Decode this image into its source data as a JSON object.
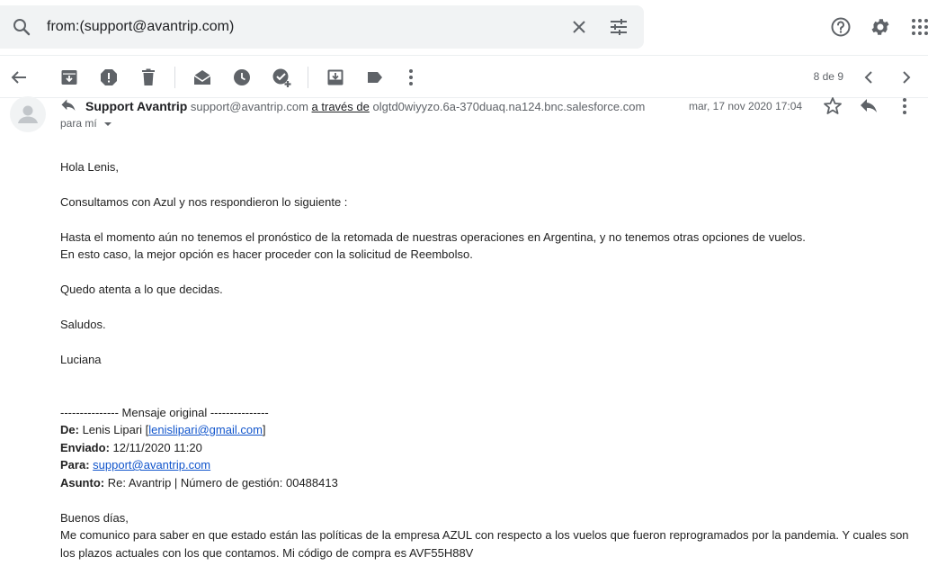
{
  "search": {
    "query": "from:(support@avantrip.com)"
  },
  "toolbar": {
    "pager": "8 de 9"
  },
  "message": {
    "sender_name": "Support Avantrip",
    "sender_email": "support@avantrip.com",
    "via_label": "a través de",
    "via_domain": "olgtd0wiyyzo.6a-370duaq.na124.bnc.salesforce.com",
    "recipient": "para mí",
    "date": "mar, 17 nov 2020 17:04"
  },
  "body": {
    "greeting": "Hola Lenis,",
    "p1": "Consultamos con Azul y nos respondieron lo siguiente :",
    "p2a": "Hasta el momento aún no tenemos el pronóstico de la retomada de nuestras operaciones en Argentina, y no tenemos otras opciones de vuelos.",
    "p2b": "En esto caso, la mejor opción es hacer proceder con la solicitud de Reembolso.",
    "p3": "Quedo atenta a lo que decidas.",
    "p4": "Saludos.",
    "signature": "Luciana",
    "orig_header": "--------------- Mensaje original ---------------",
    "de_label": "De:",
    "de_name": "Lenis Lipari [",
    "de_email": "lenislipari@gmail.com",
    "de_close": "]",
    "enviado_label": "Enviado:",
    "enviado_value": "12/11/2020 11:20",
    "para_label": "Para:",
    "para_email": "support@avantrip.com",
    "asunto_label": "Asunto:",
    "asunto_value": "Re: Avantrip | Número de gestión: 00488413",
    "q1": "Buenos días,",
    "q2a": "Me comunico para saber en que estado están las políticas de la empresa AZUL con respecto a los vuelos que fueron reprogramados por la pandemia. Y cuales son",
    "q2b": "los plazos actuales con los que contamos. Mi código de compra es AVF55H88V"
  }
}
